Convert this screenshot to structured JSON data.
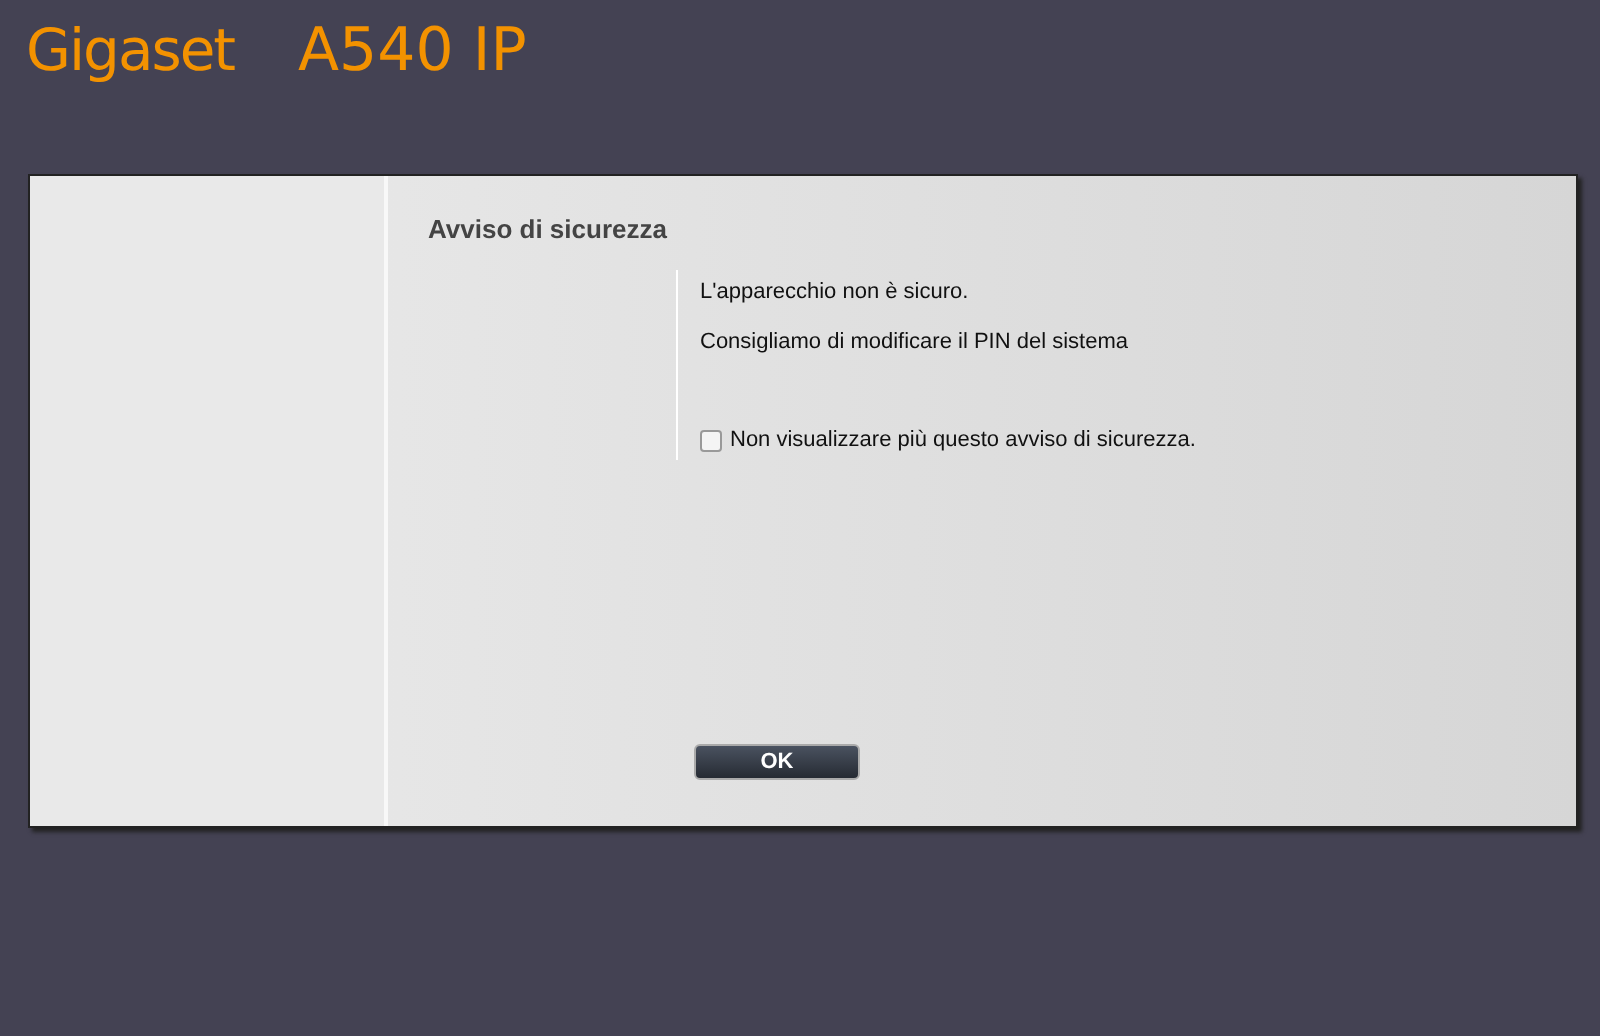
{
  "header": {
    "brand": "Gigaset",
    "model": "A540 IP"
  },
  "dialog": {
    "title": "Avviso di sicurezza",
    "messages": [
      "L'apparecchio non è sicuro.",
      "Consigliamo di modificare il PIN del sistema"
    ],
    "checkbox": {
      "label": "Non visualizzare più questo avviso di sicurezza.",
      "checked": false
    },
    "button": "OK"
  }
}
